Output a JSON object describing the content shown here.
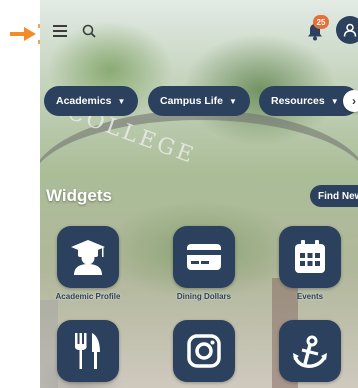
{
  "header": {
    "menu_icon": "hamburger-menu-icon",
    "search_icon": "search-icon",
    "notifications_icon": "bell-icon",
    "notifications_count": "25",
    "profile_icon": "person-icon"
  },
  "nav_pills": [
    {
      "label": "Academics"
    },
    {
      "label": "Campus Life"
    },
    {
      "label": "Resources"
    }
  ],
  "background_text": "COLLEGE",
  "widgets_section": {
    "title": "Widgets",
    "find_new_label": "Find New"
  },
  "widgets": [
    {
      "label": "Academic Profile",
      "icon": "graduate-icon"
    },
    {
      "label": "Dining Dollars",
      "icon": "credit-card-icon"
    },
    {
      "label": "Events",
      "icon": "calendar-icon"
    },
    {
      "label": "",
      "icon": "fork-knife-icon"
    },
    {
      "label": "",
      "icon": "instagram-icon"
    },
    {
      "label": "",
      "icon": "anchor-icon"
    }
  ],
  "colors": {
    "navy": "#0f2747",
    "accent_orange": "#e45b1b",
    "pointer_orange": "#f28c28"
  }
}
